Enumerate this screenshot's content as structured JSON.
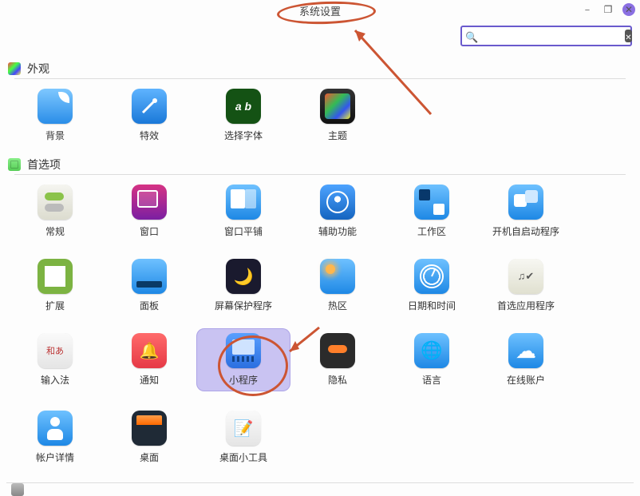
{
  "window": {
    "title": "系统设置",
    "controls": {
      "minimize": "–",
      "maximize": "❐",
      "close": "✕"
    }
  },
  "search": {
    "placeholder": "",
    "value": ""
  },
  "sections": {
    "appearance": {
      "title": "外观",
      "items": {
        "background": "背景",
        "effects": "特效",
        "fonts": "选择字体",
        "fonts_glyph": "a b",
        "themes": "主题"
      }
    },
    "preferences": {
      "title": "首选项",
      "items": {
        "general": "常规",
        "windows": "窗口",
        "tiling": "窗口平铺",
        "a11y": "辅助功能",
        "workspaces": "工作区",
        "startup": "开机自启动程序",
        "extensions": "扩展",
        "panel": "面板",
        "screensaver": "屏幕保护程序",
        "hotcorners": "热区",
        "datetime": "日期和时间",
        "defaultapps": "首选应用程序",
        "inputmethod": "输入法",
        "notifications": "通知",
        "applets": "小程序",
        "privacy": "隐私",
        "language": "语言",
        "onlineaccounts": "在线账户",
        "accountdetails": "帐户详情",
        "desktop": "桌面",
        "desklets": "桌面小工具"
      }
    }
  },
  "annotations": {
    "highlighted_title": "系统设置",
    "highlighted_item": "小程序"
  },
  "colors": {
    "accent": "#6a5acd",
    "annotation": "#cc5533",
    "selection_bg": "#c9c3f2"
  }
}
